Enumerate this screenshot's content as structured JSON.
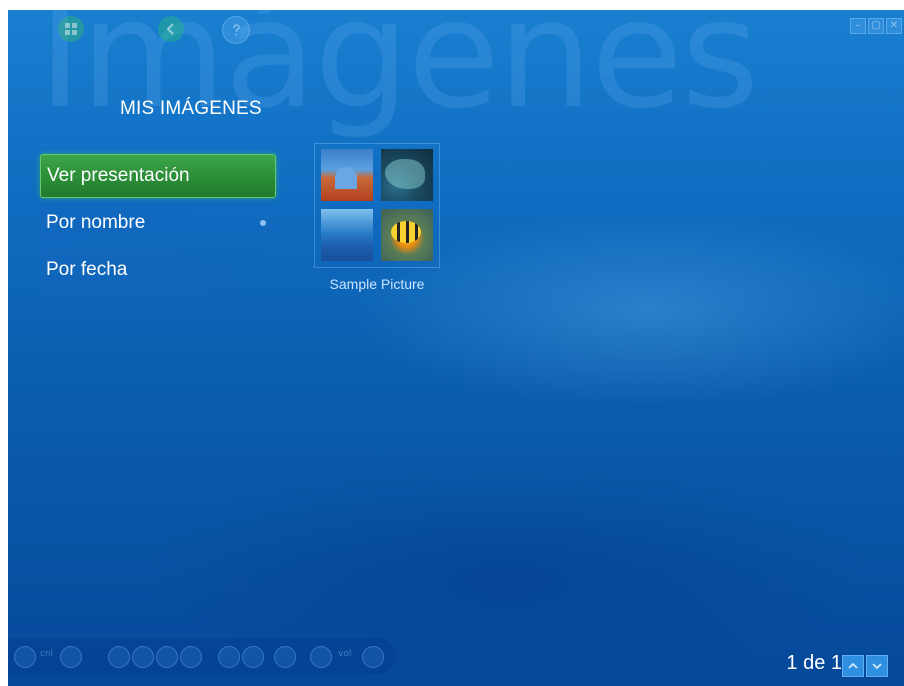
{
  "header": {
    "watermark": "Imágenes",
    "section_title": "MIS IMÁGENES"
  },
  "topbar": {
    "icons": [
      "windows-home-icon",
      "back-icon",
      "help-icon"
    ],
    "window_controls": [
      "–",
      "▢",
      "✕"
    ]
  },
  "menu": {
    "items": [
      {
        "label": "Ver presentación",
        "selected": true
      },
      {
        "label": "Por nombre",
        "selected": false,
        "indicator": true
      },
      {
        "label": "Por fecha",
        "selected": false
      }
    ]
  },
  "gallery": {
    "folder": {
      "label": "Sample Picture"
    }
  },
  "transport": {
    "labels": {
      "channel": "cnl",
      "volume": "vol"
    }
  },
  "pager": {
    "text": "1 de 1"
  },
  "colors": {
    "background_top": "#1a7fd0",
    "background_bottom": "#06489a",
    "selected_green": "#2a8b36",
    "accent_blue": "#2f8fe0"
  }
}
